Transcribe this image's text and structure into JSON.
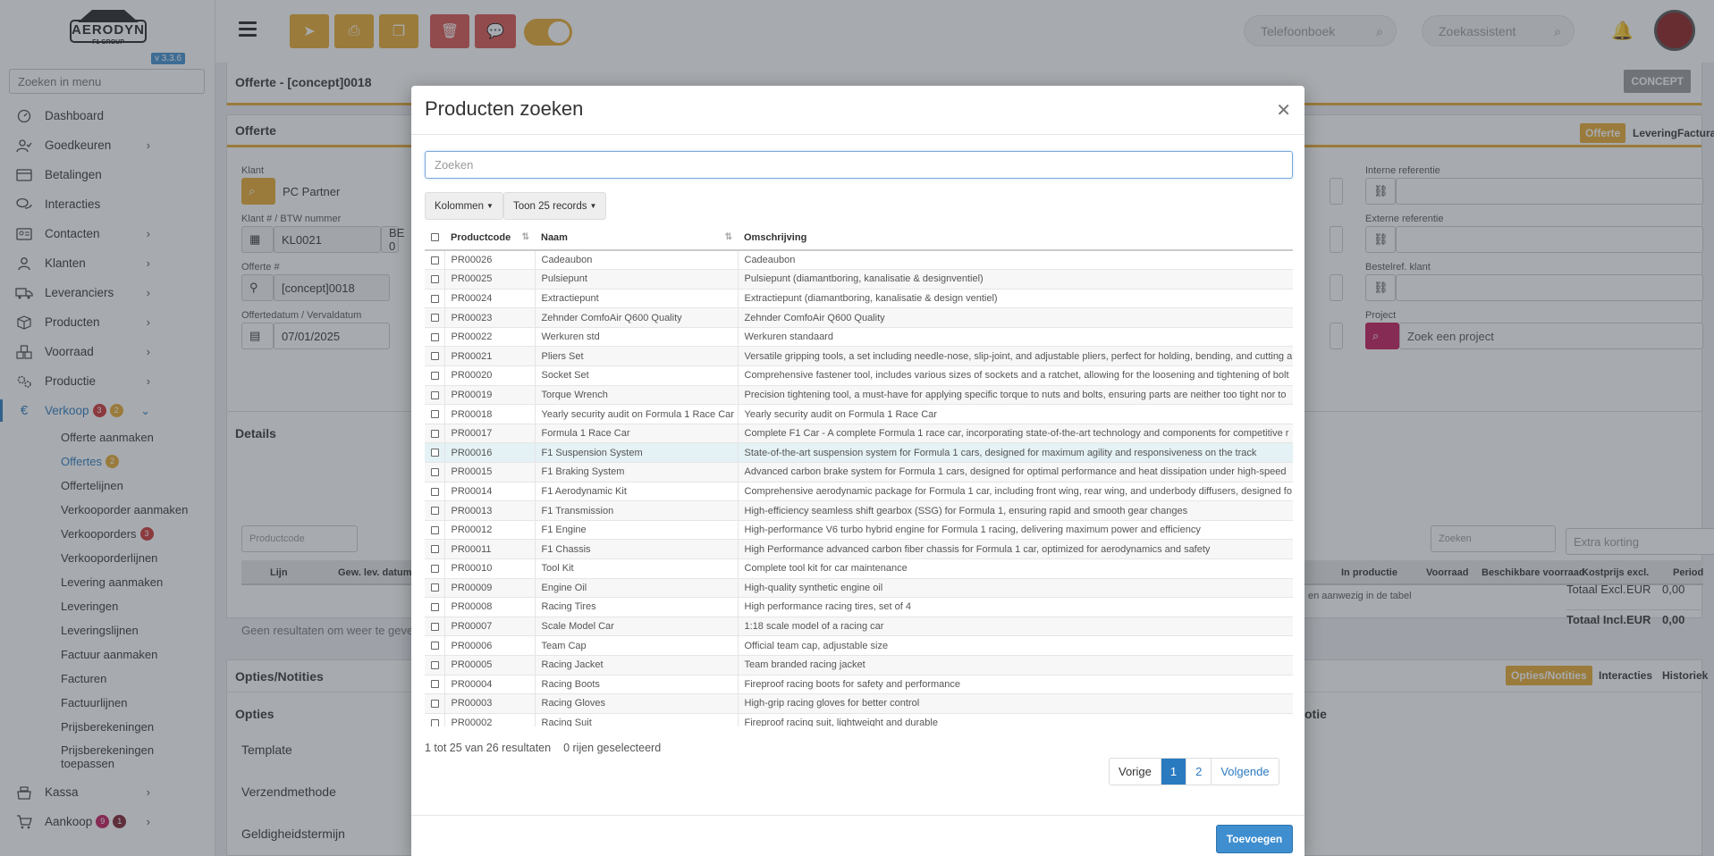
{
  "sidebar": {
    "logo_text": "AERODYN",
    "logo_sub": "F1 GROUP",
    "version": "v 3.3.6",
    "menu_search_placeholder": "Zoeken in menu",
    "items": [
      {
        "label": "Dashboard",
        "icon": "speedometer-icon",
        "chev": false
      },
      {
        "label": "Goedkeuren",
        "icon": "user-check-icon",
        "chev": true
      },
      {
        "label": "Betalingen",
        "icon": "card-icon",
        "chev": false
      },
      {
        "label": "Interacties",
        "icon": "chat-icon",
        "chev": false
      },
      {
        "label": "Contacten",
        "icon": "contact-card-icon",
        "chev": true
      },
      {
        "label": "Klanten",
        "icon": "user-icon",
        "chev": true
      },
      {
        "label": "Leveranciers",
        "icon": "truck-icon",
        "chev": true
      },
      {
        "label": "Producten",
        "icon": "box-icon",
        "chev": true
      },
      {
        "label": "Voorraad",
        "icon": "stock-icon",
        "chev": true
      },
      {
        "label": "Productie",
        "icon": "gears-icon",
        "chev": true
      }
    ],
    "verkoop": {
      "label": "Verkoop",
      "badge1": "3",
      "badge2": "2"
    },
    "sub_items": [
      {
        "label": "Offerte aanmaken",
        "badge": ""
      },
      {
        "label": "Offertes",
        "badge": "2"
      },
      {
        "label": "Offertelijnen",
        "badge": ""
      },
      {
        "label": "Verkooporder aanmaken",
        "badge": ""
      },
      {
        "label": "Verkooporders",
        "badge": "3"
      },
      {
        "label": "Verkooporderlijnen",
        "badge": ""
      },
      {
        "label": "Levering aanmaken",
        "badge": ""
      },
      {
        "label": "Leveringen",
        "badge": ""
      },
      {
        "label": "Leveringslijnen",
        "badge": ""
      },
      {
        "label": "Factuur aanmaken",
        "badge": ""
      },
      {
        "label": "Facturen",
        "badge": ""
      },
      {
        "label": "Factuurlijnen",
        "badge": ""
      },
      {
        "label": "Prijsberekeningen",
        "badge": ""
      },
      {
        "label": "Prijsberekeningen",
        "label2": "toepassen",
        "badge": ""
      }
    ],
    "kassa": "Kassa",
    "aankoop": {
      "label": "Aankoop",
      "badge1": "9",
      "badge2": "1"
    }
  },
  "topbar": {
    "phonebook_placeholder": "Telefoonboek",
    "assistant_placeholder": "Zoekassistent"
  },
  "page": {
    "title": "Offerte - [concept]0018",
    "status": "CONCEPT",
    "offerte_header": "Offerte",
    "tabs": [
      "Offerte",
      "Levering",
      "Facturatie"
    ],
    "klant_label": "Klant",
    "klant_value": "PC Partner",
    "klantnr_label": "Klant # / BTW nummer",
    "klantnr_value": "KL0021",
    "btw_value": "BE 0",
    "offertenr_label": "Offerte #",
    "offertenr_value": "[concept]0018",
    "datum_label": "Offertedatum / Vervaldatum",
    "datum_value": "07/01/2025",
    "interne_ref_label": "Interne referentie",
    "externe_ref_label": "Externe referentie",
    "bestelref_label": "Bestelref. klant",
    "project_label": "Project",
    "project_placeholder": "Zoek een project",
    "details_header": "Details",
    "productcode_placeholder": "Productcode",
    "details_search": "Zoeken",
    "extra_korting": "Extra korting",
    "details_cols": [
      "Lijn",
      "Gew. lev. datum",
      "In productie",
      "Voorraad",
      "Beschikbare voorraad",
      "Kostprijs excl.",
      "Period"
    ],
    "details_empty_left": "Geen resultaten om weer te geven",
    "details_empty_right": "en aanwezig in de tabel",
    "totaal_excl_label": "Totaal Excl.",
    "totaal_incl_label": "Totaal Incl.",
    "currency": "EUR",
    "totaal_excl": "0,00",
    "totaal_incl": "0,00",
    "opties_header": "Opties/Notities",
    "opties_tabs": [
      "Opties/Notities",
      "Interacties",
      "Historiek"
    ],
    "opties_sub": "Opties",
    "opties_sub_right": "otie",
    "template_label": "Template",
    "verzend_label": "Verzendmethode",
    "geldig_label": "Geldigheidstermijn"
  },
  "modal": {
    "title": "Producten zoeken",
    "search_placeholder": "Zoeken",
    "columns_btn": "Kolommen",
    "show_btn": "Toon 25 records",
    "headers": [
      "Productcode",
      "Naam",
      "Omschrijving"
    ],
    "rows": [
      [
        "PR00026",
        "Cadeaubon",
        "Cadeaubon"
      ],
      [
        "PR00025",
        "Pulsiepunt",
        "Pulsiepunt (diamantboring, kanalisatie & designventiel)"
      ],
      [
        "PR00024",
        "Extractiepunt",
        "Extractiepunt (diamantboring, kanalisatie & design ventiel)"
      ],
      [
        "PR00023",
        "Zehnder ComfoAir Q600 Quality",
        "Zehnder ComfoAir Q600 Quality"
      ],
      [
        "PR00022",
        "Werkuren std",
        "Werkuren standaard"
      ],
      [
        "PR00021",
        "Pliers Set",
        "Versatile gripping tools, a set including needle-nose, slip-joint, and adjustable pliers, perfect for holding, bending, and cutting a"
      ],
      [
        "PR00020",
        "Socket Set",
        "Comprehensive fastener tool, includes various sizes of sockets and a ratchet, allowing for the loosening and tightening of bolt"
      ],
      [
        "PR00019",
        "Torque Wrench",
        "Precision tightening tool, a must-have for applying specific torque to nuts and bolts, ensuring parts are neither too tight nor to"
      ],
      [
        "PR00018",
        "Yearly security audit on Formula 1 Race Car",
        "Yearly security audit on Formula 1 Race Car"
      ],
      [
        "PR00017",
        "Formula 1 Race Car",
        "Complete F1 Car - A complete Formula 1 race car, incorporating state-of-the-art technology and components for competitive r"
      ],
      [
        "PR00016",
        "F1 Suspension System",
        "State-of-the-art suspension system for Formula 1 cars, designed for maximum agility and responsiveness on the track"
      ],
      [
        "PR00015",
        "F1 Braking System",
        "Advanced carbon brake system for Formula 1 cars, designed for optimal performance and heat dissipation under high-speed"
      ],
      [
        "PR00014",
        "F1 Aerodynamic Kit",
        "Comprehensive aerodynamic package for Formula 1 car, including front wing, rear wing, and underbody diffusers, designed fo"
      ],
      [
        "PR00013",
        "F1 Transmission",
        "High-efficiency seamless shift gearbox (SSG) for Formula 1, ensuring rapid and smooth gear changes"
      ],
      [
        "PR00012",
        "F1 Engine",
        "High-performance V6 turbo hybrid engine for Formula 1 racing, delivering maximum power and efficiency"
      ],
      [
        "PR00011",
        "F1 Chassis",
        "High Performance advanced carbon fiber chassis for Formula 1 car, optimized for aerodynamics and safety"
      ],
      [
        "PR00010",
        "Tool Kit",
        "Complete tool kit for car maintenance"
      ],
      [
        "PR00009",
        "Engine Oil",
        "High-quality synthetic engine oil"
      ],
      [
        "PR00008",
        "Racing Tires",
        "High performance racing tires, set of 4"
      ],
      [
        "PR00007",
        "Scale Model Car",
        "1:18 scale model of a racing car"
      ],
      [
        "PR00006",
        "Team Cap",
        "Official team cap, adjustable size"
      ],
      [
        "PR00005",
        "Racing Jacket",
        "Team branded racing jacket"
      ],
      [
        "PR00004",
        "Racing Boots",
        "Fireproof racing boots for safety and performance"
      ],
      [
        "PR00003",
        "Racing Gloves",
        "High-grip racing gloves for better control"
      ],
      [
        "PR00002",
        "Racing Suit",
        "Fireproof racing suit, lightweight and durable"
      ]
    ],
    "info": "1 tot 25 van 26 resultaten",
    "selected": "0 rijen geselecteerd",
    "prev": "Vorige",
    "page1": "1",
    "page2": "2",
    "next": "Volgende",
    "add_btn": "Toevoegen"
  },
  "colors": {
    "accent": "#e7a92e",
    "primary": "#3e8ed0",
    "danger": "#d9534f",
    "active_nav": "#2a7ac0"
  }
}
